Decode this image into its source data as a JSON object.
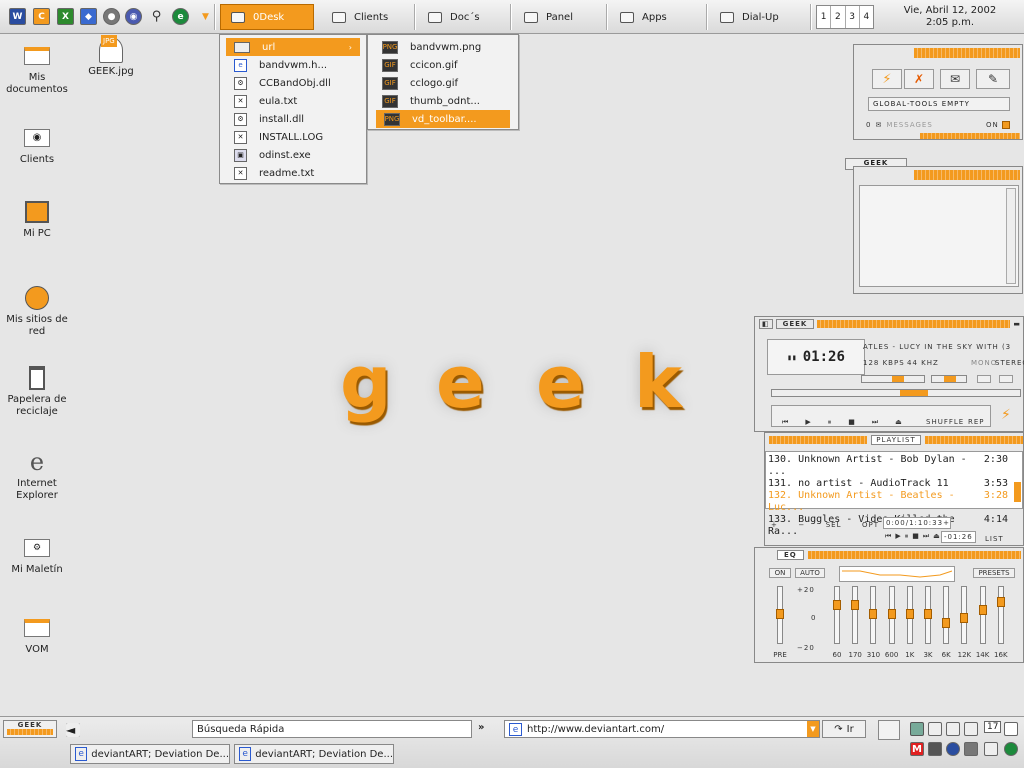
{
  "taskbar": {
    "buttons": [
      {
        "label": "0Desk"
      },
      {
        "label": "Clients"
      },
      {
        "label": "Doc´s"
      },
      {
        "label": "Panel"
      },
      {
        "label": "Apps"
      },
      {
        "label": "Dial-Up"
      }
    ],
    "workspaces": [
      "1",
      "2",
      "3",
      "4"
    ],
    "date": "Vie, Abril 12, 2002",
    "time": "2:05 p.m."
  },
  "menu1": {
    "items": [
      {
        "label": "url",
        "type": "folder"
      },
      {
        "label": "bandvwm.h...",
        "type": "ie"
      },
      {
        "label": "CCBandObj.dll",
        "type": "dll"
      },
      {
        "label": "eula.txt",
        "type": "txt"
      },
      {
        "label": "install.dll",
        "type": "dll"
      },
      {
        "label": "INSTALL.LOG",
        "type": "txt"
      },
      {
        "label": "odinst.exe",
        "type": "exe"
      },
      {
        "label": "readme.txt",
        "type": "txt"
      }
    ]
  },
  "menu2": {
    "items": [
      {
        "label": "bandvwm.png",
        "badge": "PNG"
      },
      {
        "label": "ccicon.gif",
        "badge": "GIF"
      },
      {
        "label": "cclogo.gif",
        "badge": "GIF"
      },
      {
        "label": "thumb_odnt...",
        "badge": "GIF"
      },
      {
        "label": "vd_toolbar....",
        "badge": "PNG"
      }
    ]
  },
  "desktop": {
    "icons": [
      {
        "label": "GEEK.jpg",
        "badge": "JPG"
      },
      {
        "label": "Mis documentos"
      },
      {
        "label": "Clients"
      },
      {
        "label": "Mi PC"
      },
      {
        "label": "Mis sitios de red"
      },
      {
        "label": "Papelera de reciclaje"
      },
      {
        "label": "Internet Explorer"
      },
      {
        "label": "Mi Maletín"
      },
      {
        "label": "VOM"
      }
    ],
    "wallpaper_text": [
      "g",
      "e",
      "e",
      "k"
    ]
  },
  "widget": {
    "status": "GLOBAL-TOOLS EMPTY",
    "messages_count": "0",
    "messages_label": "MESSAGES",
    "on_label": "ON",
    "geek_tab": "GEEK"
  },
  "player": {
    "title": "GEEK",
    "time": "01:26",
    "track": "ATLES - LUCY IN THE SKY WITH (3",
    "kbps": "128 KBPS",
    "khz": "44 KHZ",
    "mono": "MONO",
    "stereo": "STEREO",
    "shuffle": "SHUFFLE",
    "rep": "REP"
  },
  "playlist": {
    "title": "PLAYLIST",
    "rows": [
      {
        "text": "130. Unknown Artist - Bob Dylan - ...",
        "dur": "2:30"
      },
      {
        "text": "131. no artist - AudioTrack 11",
        "dur": "3:53"
      },
      {
        "text": "132. Unknown Artist - Beatles - Luc...",
        "dur": "3:28"
      },
      {
        "text": "133. Buggles - Video Killed the Ra...",
        "dur": "4:14"
      }
    ],
    "total": "0:00/1:10:33+",
    "remaining": "-01:26",
    "buttons": [
      "+",
      "−",
      "SEL",
      "OPT"
    ],
    "list": "LIST"
  },
  "eq": {
    "title": "EQ",
    "on": "ON",
    "auto": "AUTO",
    "presets": "PRESETS",
    "scale": [
      "+20",
      "0",
      "−20"
    ],
    "preamp_label": "PRE",
    "preamp_level": 0.55,
    "bands": [
      {
        "label": "60",
        "level": 0.72
      },
      {
        "label": "170",
        "level": 0.72
      },
      {
        "label": "310",
        "level": 0.55
      },
      {
        "label": "600",
        "level": 0.55
      },
      {
        "label": "1K",
        "level": 0.55
      },
      {
        "label": "3K",
        "level": 0.55
      },
      {
        "label": "6K",
        "level": 0.35
      },
      {
        "label": "12K",
        "level": 0.45
      },
      {
        "label": "14K",
        "level": 0.62
      },
      {
        "label": "16K",
        "level": 0.8
      }
    ]
  },
  "bottom": {
    "logo": "GEEK",
    "search_placeholder": "Búsqueda Rápida",
    "address": "http://www.deviantart.com/",
    "go_label": "Ir",
    "tasks": [
      "deviantART; Deviation De...",
      "deviantART; Deviation De..."
    ],
    "tray_number": "17"
  },
  "colors": {
    "accent": "#f39a1e",
    "dark_accent": "#b86a00",
    "bg": "#e6e6e6"
  }
}
